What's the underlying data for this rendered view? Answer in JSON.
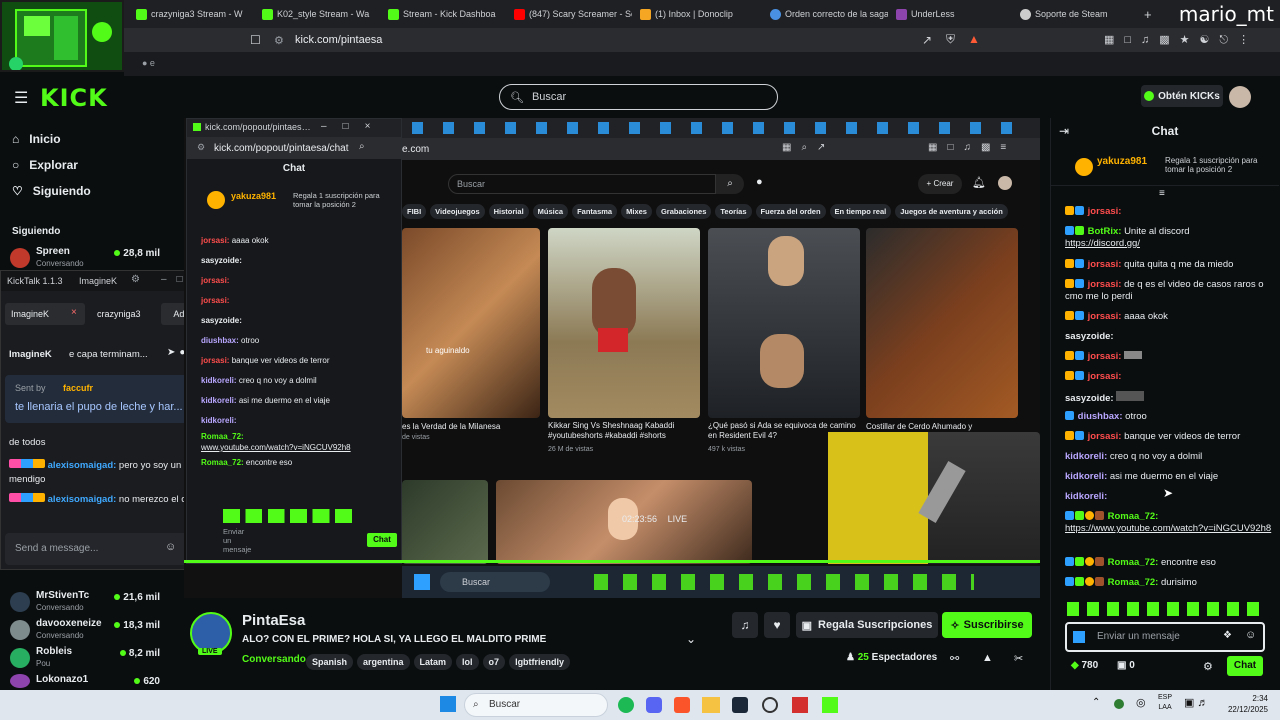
{
  "browser": {
    "tabs": [
      {
        "label": "crazyniga3 Stream - W",
        "color": "#53fc18"
      },
      {
        "label": "K02_style Stream - Wa",
        "color": "#53fc18"
      },
      {
        "label": "Stream - Kick Dashboa",
        "color": "#53fc18"
      },
      {
        "label": "(847) Scary Screamer - Sc",
        "color": "#ff0000"
      },
      {
        "label": "(1) Inbox | Donoclip",
        "color": "#f5a623"
      },
      {
        "label": "Orden correcto de la saga",
        "color": "#4a90e2"
      },
      {
        "label": "UnderLess",
        "color": "#8e44ad"
      },
      {
        "label": "Soporte de Steam",
        "color": "#cccccc"
      }
    ],
    "url": "kick.com/pintaesa",
    "user_tag": "mario_mt"
  },
  "kick": {
    "logo": "KICK",
    "search_placeholder": "Buscar",
    "kicks_button": "Obtén KICKs",
    "nav": [
      "Inicio",
      "Explorar",
      "Siguiendo"
    ],
    "following_header": "Siguiendo",
    "following": [
      {
        "name": "Spreen",
        "status": "Conversando",
        "viewers": "28,8 mil",
        "color": "#c0392b"
      },
      {
        "name": "MrStivenTc",
        "status": "Conversando",
        "viewers": "21,6 mil",
        "color": "#2c3e50"
      },
      {
        "name": "davooxeneize",
        "status": "Conversando",
        "viewers": "18,3 mil",
        "color": "#7f8c8d"
      },
      {
        "name": "Robleis",
        "status": "Pou",
        "viewers": "8,2 mil",
        "color": "#27ae60"
      },
      {
        "name": "Lokonazo1",
        "status": "",
        "viewers": "620",
        "color": "#8e44ad"
      }
    ]
  },
  "kicktalk": {
    "title": "KickTalk 1.1.3",
    "account": "ImagineK",
    "tabs": [
      "ImagineK",
      "crazyniga3"
    ],
    "add_label": "Add",
    "header_user": "ImagineK",
    "header_text": "e capa terminam...",
    "reply_prefix": "Sent by",
    "reply_user": "faccufr",
    "reply_text": "te llenaria el pupo de leche y har...",
    "lines": [
      {
        "user": "",
        "text": "de todos"
      },
      {
        "user": "alexisomaigad:",
        "text": "pero yo soy un simple mendigo"
      },
      {
        "user": "alexisomaigad:",
        "text": "no merezco el odio"
      }
    ],
    "input_placeholder": "Send a message..."
  },
  "popout": {
    "url": "kick.com/popout/pintaesa/chat",
    "title": "Chat",
    "sub_user": "yakuza981",
    "sub_text": "Regala 1 suscripción para tomar la posición 2",
    "lines": [
      {
        "user": "jorsasi:",
        "text": "aaaa okok"
      },
      {
        "user": "sasyzoide:",
        "text": ""
      },
      {
        "user": "jorsasi:",
        "text": ""
      },
      {
        "user": "jorsasi:",
        "text": ""
      },
      {
        "user": "sasyzoide:",
        "text": ""
      },
      {
        "user": "diushbax:",
        "text": "otroo"
      },
      {
        "user": "jorsasi:",
        "text": "banque ver videos de terror"
      },
      {
        "user": "kidkoreli:",
        "text": "creo q no voy a dolmil"
      },
      {
        "user": "kidkoreli:",
        "text": "asi me duermo en el viaje"
      },
      {
        "user": "kidkoreli:",
        "text": ""
      },
      {
        "user": "Romaa_72:",
        "text": "www.youtube.com/watch?v=iNGCUV92h8"
      },
      {
        "user": "Romaa_72:",
        "text": "encontre eso"
      }
    ],
    "chat_button": "Chat",
    "input_placeholder": "Enviar un mensaje"
  },
  "youtube": {
    "url": "e.com",
    "search_placeholder": "Buscar",
    "create_label": "Crear",
    "chips": [
      "FIBI",
      "Videojuegos",
      "Historial",
      "Música",
      "Fantasma",
      "Mixes",
      "Grabaciones",
      "Teorías",
      "Fuerza del orden",
      "En tiempo real",
      "Juegos de aventura y acción"
    ],
    "videos": [
      {
        "title": "es la Verdad de la Milanesa",
        "meta": "de vistas"
      },
      {
        "title": "Kikkar Sing Vs Sheshnaag Kabaddi #youtubeshorts #kabaddi #shorts",
        "meta": "26 M de vistas"
      },
      {
        "title": "¿Qué pasó si Ada se equivoca de camino en Resident Evil 4?",
        "meta": "497 k vistas"
      },
      {
        "title": "Costillar de Cerdo Ahumado y",
        "meta": ""
      }
    ],
    "thumb_caption": "tu aguinaldo",
    "timer": "02:23:56",
    "live": "LIVE",
    "stream_search": "Buscar"
  },
  "stream": {
    "name": "PintaEsa",
    "live_badge": "LIVE",
    "title": "ALO? CON EL PRIME? HOLA SI, YA LLEGO EL MALDITO PRIME",
    "category": "Conversando",
    "tags": [
      "Spanish",
      "argentina",
      "Latam",
      "lol",
      "o7",
      "lgbtfriendly"
    ],
    "gift_button": "Regala Suscripciones",
    "subscribe_button": "Suscribirse",
    "viewers_count": "25",
    "viewers_label": "Espectadores"
  },
  "chat": {
    "title": "Chat",
    "pinned_user": "yakuza981",
    "pinned_text": "Regala 1 suscripción para tomar la posición 2",
    "messages": [
      {
        "user": "jorsasi:",
        "text": "",
        "color": "#ff4d4d",
        "link": ""
      },
      {
        "user": "BotRix:",
        "text": "Unite al discord",
        "color": "#53fc18",
        "link": "https://discord.gg/"
      },
      {
        "user": "jorsasi:",
        "text": "quita quita q me da miedo",
        "color": "#ff4d4d",
        "link": ""
      },
      {
        "user": "jorsasi:",
        "text": "de q es el video de casos raros o cmo me lo perdi",
        "color": "#ff4d4d",
        "link": ""
      },
      {
        "user": "jorsasi:",
        "text": "aaaa okok",
        "color": "#ff4d4d",
        "link": ""
      },
      {
        "user": "sasyzoide:",
        "text": "",
        "color": "#e9ecef",
        "link": ""
      },
      {
        "user": "jorsasi:",
        "text": "",
        "color": "#ff4d4d",
        "link": ""
      },
      {
        "user": "jorsasi:",
        "text": "",
        "color": "#ff4d4d",
        "link": ""
      },
      {
        "user": "sasyzoide:",
        "text": "",
        "color": "#e9ecef",
        "link": ""
      },
      {
        "user": "diushbax:",
        "text": "otroo",
        "color": "#b9a7ff",
        "link": ""
      },
      {
        "user": "jorsasi:",
        "text": "banque ver videos de terror",
        "color": "#ff4d4d",
        "link": ""
      },
      {
        "user": "kidkoreli:",
        "text": "creo q no voy a dolmil",
        "color": "#b9a7ff",
        "link": ""
      },
      {
        "user": "kidkoreli:",
        "text": "asi me duermo en el viaje",
        "color": "#b9a7ff",
        "link": ""
      },
      {
        "user": "kidkoreli:",
        "text": "",
        "color": "#b9a7ff",
        "link": ""
      },
      {
        "user": "Romaa_72:",
        "text": "",
        "color": "#53fc18",
        "link": "https://www.youtube.com/watch?v=iNGCUV92h8"
      },
      {
        "user": "Romaa_72:",
        "text": "encontre eso",
        "color": "#53fc18",
        "link": ""
      },
      {
        "user": "Romaa_72:",
        "text": "durisimo",
        "color": "#53fc18",
        "link": ""
      }
    ],
    "input_placeholder": "Enviar un mensaje",
    "points": "780",
    "gifts": "0",
    "send_button": "Chat"
  },
  "taskbar": {
    "search_placeholder": "Buscar",
    "lang_top": "ESP",
    "lang_bottom": "LAA",
    "time": "2:34",
    "date": "22/12/2025"
  }
}
